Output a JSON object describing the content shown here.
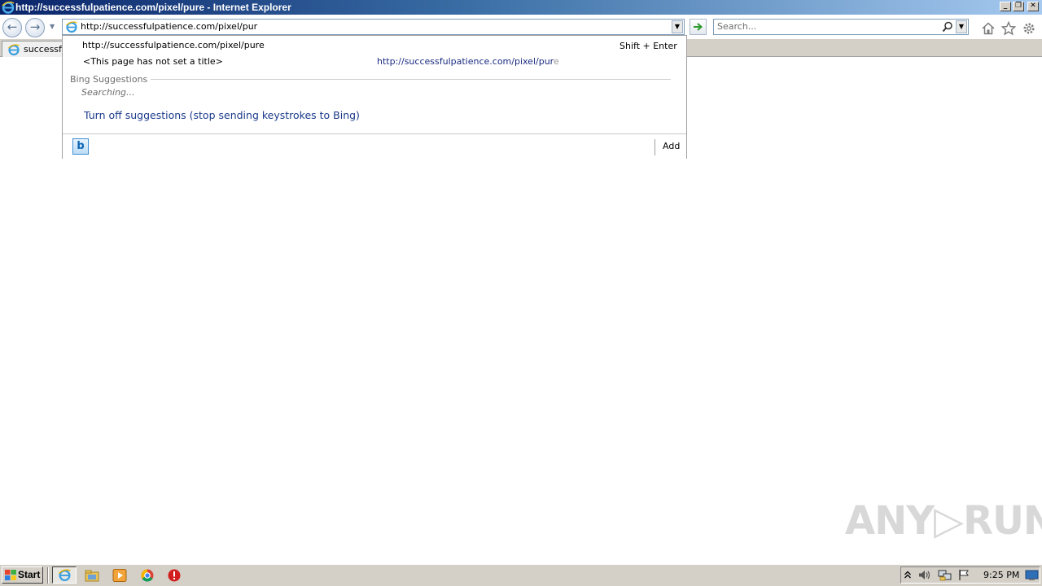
{
  "window": {
    "title": "http://successfulpatience.com/pixel/pure - Internet Explorer",
    "controls": {
      "minimize": "_",
      "restore": "❐",
      "close": "✕"
    }
  },
  "nav": {
    "back_glyph": "←",
    "forward_glyph": "→",
    "address_value": "http://successfulpatience.com/pixel/pur",
    "search_placeholder": "Search..."
  },
  "tab": {
    "label": "successfulpatience.com"
  },
  "suggestions": {
    "url_entry": "http://successfulpatience.com/pixel/pure",
    "shift_hint": "Shift + Enter",
    "history_title": "<This page has not set a title>",
    "history_url_typed": "http://successfulpatience.com/pixel/pur",
    "history_url_rest": "e",
    "bing_heading": "Bing Suggestions",
    "searching": "Searching...",
    "turn_off": "Turn off suggestions (stop sending keystrokes to Bing)",
    "bing_button": "b",
    "add": "Add"
  },
  "watermark": {
    "text": "ANY▷RUN"
  },
  "taskbar": {
    "start": "Start",
    "clock": "9:25 PM",
    "pinned": [
      "internet-explorer-icon",
      "file-explorer-icon",
      "media-player-icon",
      "chrome-icon",
      "stop-icon"
    ]
  },
  "colors": {
    "title_start": "#0a246a",
    "title_end": "#a6caf0",
    "link": "#1a3a8a",
    "taskbar": "#d4d0c8"
  }
}
